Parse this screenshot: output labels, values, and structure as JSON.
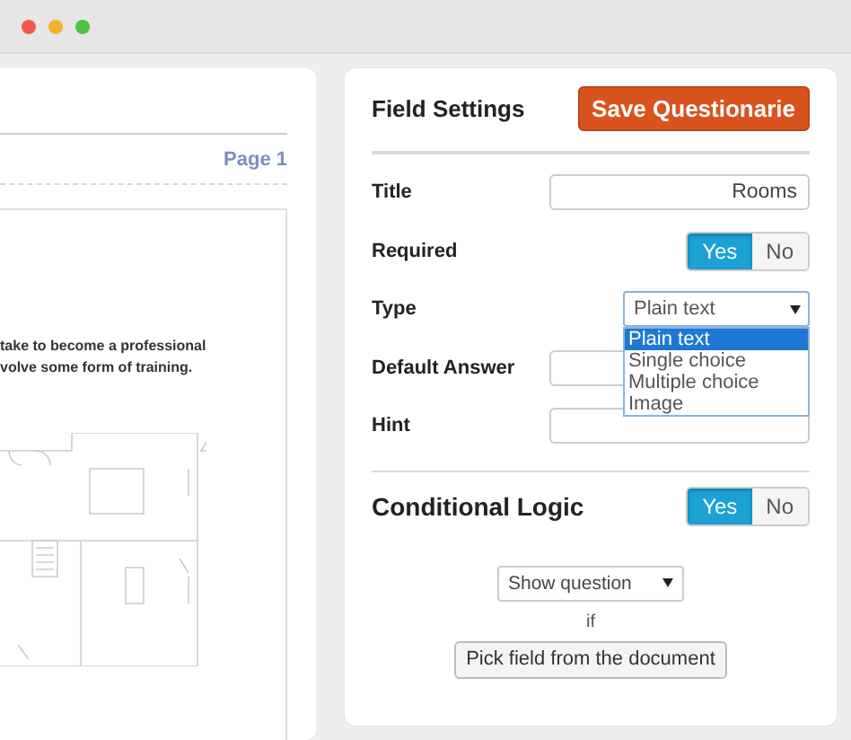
{
  "document": {
    "page_label": "Page 1",
    "text_lines": [
      "take to become a professional",
      "volve some form of training."
    ]
  },
  "field_settings": {
    "title": "Field Settings",
    "save_button": "Save Questionarie",
    "fields": [
      {
        "kind": "text",
        "label": "Title",
        "value": "Rooms"
      },
      {
        "kind": "toggle",
        "label": "Required",
        "options": [
          {
            "label": "Yes",
            "selected": true
          },
          {
            "label": "No",
            "selected": false
          }
        ]
      },
      {
        "kind": "select",
        "label": "Type",
        "value": "Plain text",
        "expanded": true,
        "options": [
          {
            "label": "Plain text",
            "selected": true
          },
          {
            "label": "Single choice",
            "selected": false
          },
          {
            "label": "Multiple choice",
            "selected": false
          },
          {
            "label": "Image",
            "selected": false
          }
        ]
      },
      {
        "kind": "text",
        "label": "Default Answer"
      },
      {
        "kind": "text",
        "label": "Hint"
      }
    ]
  },
  "conditional_logic": {
    "title": "Conditional Logic",
    "options": [
      {
        "label": "Yes",
        "selected": true
      },
      {
        "label": "No",
        "selected": false
      }
    ],
    "action": {
      "value": "Show question"
    },
    "connector": "if",
    "pick_button": "Pick field from the document"
  }
}
